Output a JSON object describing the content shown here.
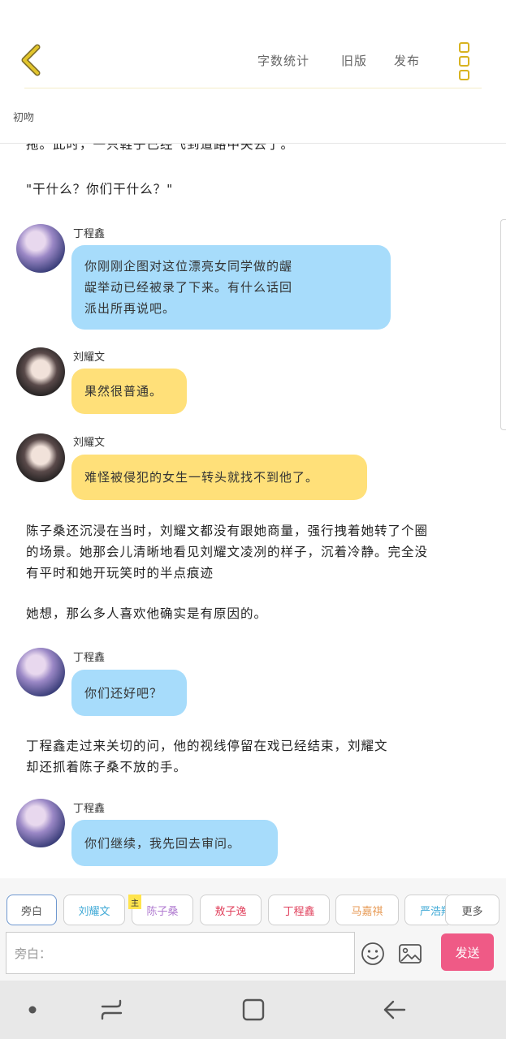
{
  "header": {
    "word_count": "字数统计",
    "old_version": "旧版",
    "publish": "发布"
  },
  "chapter_title": "初吻",
  "story": {
    "partial_line": "拖。此时，一只鞋子已经飞到道路中央去了。",
    "narration_1": "\"干什么？你们干什么？\"",
    "msg_1": {
      "speaker": "丁程鑫",
      "text_l1": "你刚刚企图对这位漂亮女同学做的龌",
      "text_l2": "龊举动已经被录了下来。有什么话回",
      "text_l3": "派出所再说吧。"
    },
    "msg_2": {
      "speaker": "刘耀文",
      "text": "果然很普通。"
    },
    "msg_3": {
      "speaker": "刘耀文",
      "text": "难怪被侵犯的女生一转头就找不到他了。"
    },
    "narration_2_l1": "陈子桑还沉浸在当时，刘耀文都没有跟她商量，强行拽着她转了个圈",
    "narration_2_l2": "的场景。她那会儿清晰地看见刘耀文凌冽的样子，沉着冷静。完全没",
    "narration_2_l3": "有平时和她开玩笑时的半点痕迹",
    "narration_3": "她想，那么多人喜欢他确实是有原因的。",
    "msg_4": {
      "speaker": "丁程鑫",
      "text": "你们还好吧？"
    },
    "narration_4_l1": "丁程鑫走过来关切的问，他的视线停留在戏已经结束，刘耀文",
    "narration_4_l2": "却还抓着陈子桑不放的手。",
    "msg_5": {
      "speaker": "丁程鑫",
      "text": "你们继续，我先回去审问。"
    }
  },
  "roles": {
    "aside": "旁白",
    "liu": "刘耀文",
    "main_tag": "主",
    "chen": "陈子桑",
    "shu": "敖子逸",
    "ding": "丁程鑫",
    "ma": "马嘉祺",
    "yan": "严浩翔",
    "more": "更多"
  },
  "composer": {
    "placeholder": "旁白：",
    "send": "发送"
  },
  "colors": {
    "accent_yellow": "#d8b320",
    "bubble_blue": "#a7dcfb",
    "bubble_yellow": "#ffe079",
    "send_pink": "#ef5a86"
  },
  "icons": {
    "back": "chevron-left-icon",
    "more": "more-vertical-icon",
    "emoji": "smiley-icon",
    "image": "image-icon"
  }
}
